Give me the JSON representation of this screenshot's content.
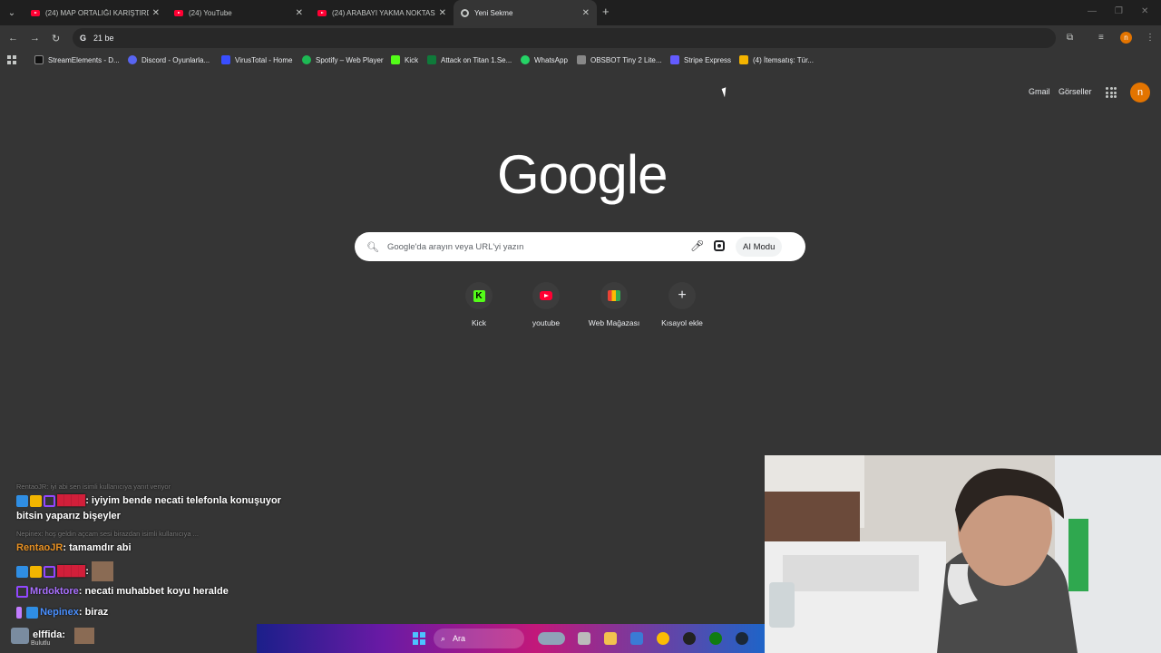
{
  "tabs": [
    {
      "label": "(24) MAP ORTALIĞI KARIŞTIRDI",
      "icon": "youtube-icon"
    },
    {
      "label": "(24) YouTube",
      "icon": "youtube-icon"
    },
    {
      "label": "(24) ARABAYI YAKMA NOKTASI",
      "icon": "youtube-icon"
    },
    {
      "label": "Yeni Sekme",
      "icon": "google-icon"
    }
  ],
  "omnibox": {
    "value": "21 be"
  },
  "bookmarks": [
    {
      "label": "StreamElements - D...",
      "color": "#111111"
    },
    {
      "label": "Discord - Oyunlarla...",
      "color": "#5865f2"
    },
    {
      "label": "VirusTotal - Home",
      "color": "#394eff"
    },
    {
      "label": "Spotify – Web Player",
      "color": "#1db954"
    },
    {
      "label": "Kick",
      "color": "#53fc18"
    },
    {
      "label": "Attack on Titan 1.Se...",
      "color": "#0f7a3a"
    },
    {
      "label": "WhatsApp",
      "color": "#25d366"
    },
    {
      "label": "OBSBOT Tiny 2 Lite...",
      "color": "#888888"
    },
    {
      "label": "Stripe Express",
      "color": "#635bff"
    },
    {
      "label": "(4) İtemsatış: Tür...",
      "color": "#f4b400"
    }
  ],
  "header": {
    "gmail": "Gmail",
    "images": "Görseller",
    "avatar_letter": "n"
  },
  "logo": "Google",
  "search": {
    "placeholder": "Google'da arayın veya URL'yi yazın",
    "ai_mode": "AI Modu"
  },
  "shortcuts": [
    {
      "label": "Kick"
    },
    {
      "label": "youtube"
    },
    {
      "label": "Web Mağazası"
    },
    {
      "label": "Kısayol ekle"
    }
  ],
  "chat": {
    "reply1": "RentaoJR: iyi abi sen isimli kullanıcıya yanıt veriyor",
    "msg1_text": ": iyiyim bende necati telefonla konuşuyor bitsin yaparız bişeyler",
    "reply2": "Nepinex: hoş geldin açcam sesi birazdan isimli kullanıcıya ...",
    "msg2_user": "RentaoJR",
    "msg2_text": ": tamamdır abi",
    "msg3_text": ":",
    "msg4_user": "Mrdoktore",
    "msg4_text": ": necati muhabbet koyu heralde",
    "msg5_user": "Nepinex",
    "msg5_text": ": biraz",
    "streamer": "elffida:",
    "streamer_sub": "Bulutlu"
  },
  "taskbar": {
    "search_label": "Ara"
  }
}
